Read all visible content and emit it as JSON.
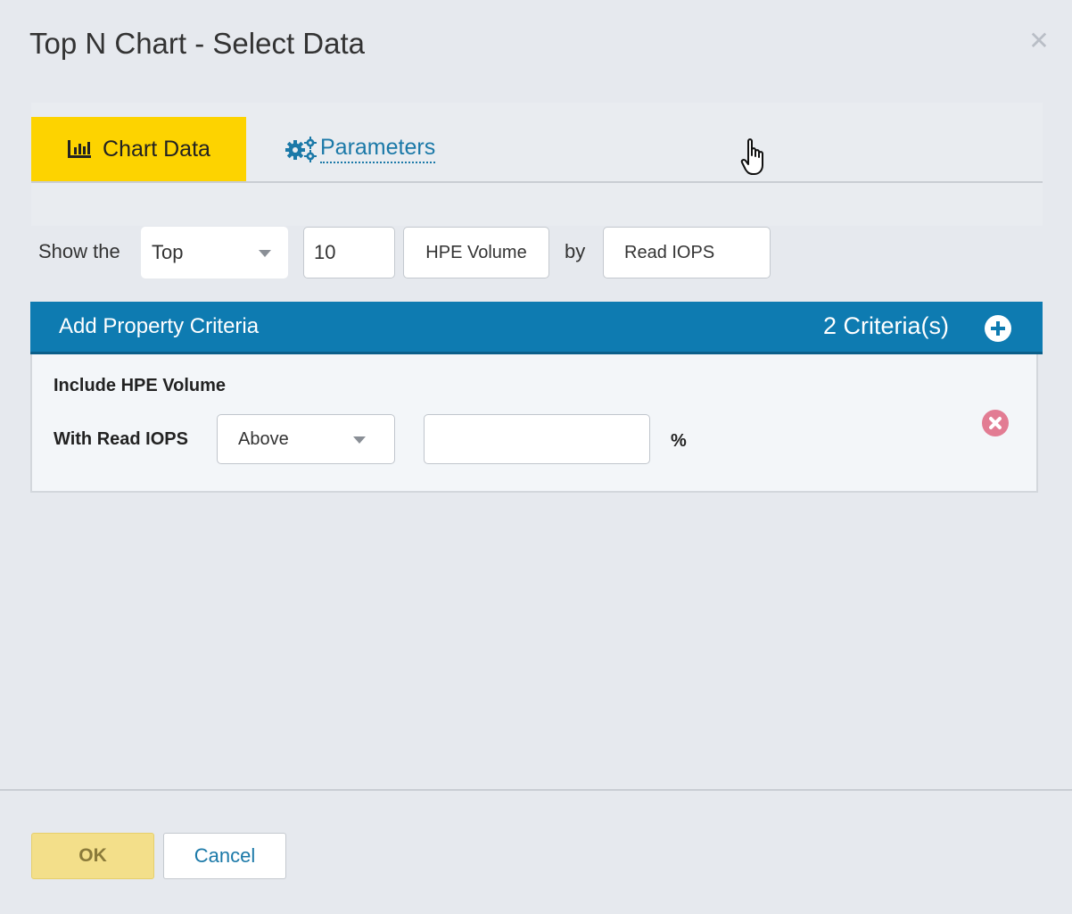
{
  "dialog": {
    "title": "Top N Chart - Select Data",
    "close_icon": "close-icon"
  },
  "tabs": [
    {
      "label": "Chart Data",
      "icon": "bar-chart-icon",
      "active": true
    },
    {
      "label": "Parameters",
      "icon": "gears-icon",
      "active": false
    }
  ],
  "query": {
    "show_label": "Show the",
    "direction": "Top",
    "count": "10",
    "entity": "HPE Volume",
    "by_label": "by",
    "metric": "Read IOPS"
  },
  "criteria": {
    "header": "Add Property Criteria",
    "count_label": "2 Criteria(s)",
    "add_icon": "plus-circle-icon",
    "item": {
      "title": "Include HPE Volume",
      "with_label": "With Read IOPS",
      "operator": "Above",
      "value": "",
      "unit": "%",
      "remove_icon": "remove-circle-icon"
    }
  },
  "footer": {
    "ok_label": "OK",
    "cancel_label": "Cancel"
  },
  "colors": {
    "active_tab": "#fdd300",
    "criteria_header": "#0e7bb1",
    "link": "#1b79a8",
    "remove": "#e27c93"
  }
}
